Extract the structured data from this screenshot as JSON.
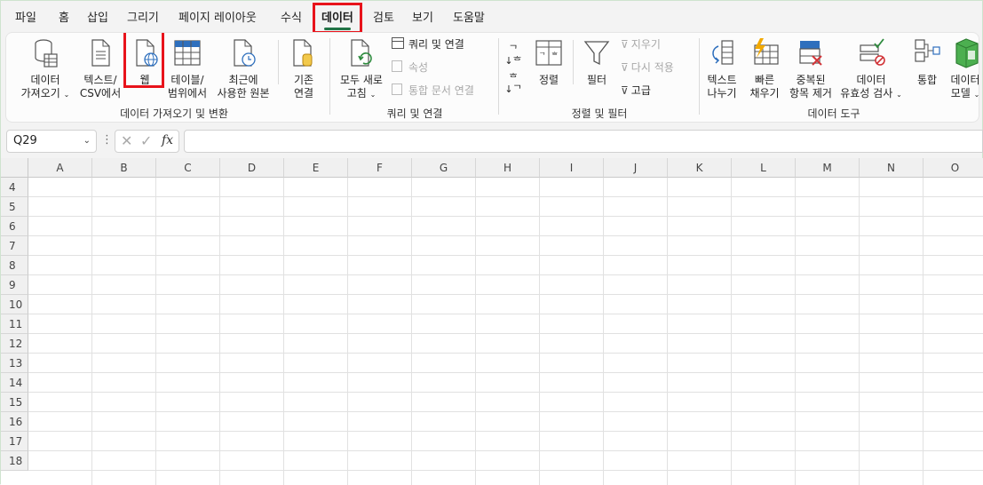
{
  "tabs": [
    {
      "label": "파일"
    },
    {
      "label": "홈"
    },
    {
      "label": "삽입"
    },
    {
      "label": "그리기"
    },
    {
      "label": "페이지 레이아웃"
    },
    {
      "label": "수식"
    },
    {
      "label": "데이터"
    },
    {
      "label": "검토"
    },
    {
      "label": "보기"
    },
    {
      "label": "도움말"
    }
  ],
  "ribbon": {
    "get_data": {
      "line1": "데이터",
      "line2": "가져오기"
    },
    "text_csv": {
      "line1": "텍스트/",
      "line2": "CSV에서"
    },
    "web": {
      "line1": "웹"
    },
    "table_range": {
      "line1": "테이블/",
      "line2": "범위에서"
    },
    "recent_sources": {
      "line1": "최근에",
      "line2": "사용한 원본"
    },
    "existing_conn": {
      "line1": "기존",
      "line2": "연결"
    },
    "group_get_transform": "데이터 가져오기 및 변환",
    "refresh_all": {
      "line1": "모두 새로",
      "line2": "고침"
    },
    "queries_conn": "쿼리 및 연결",
    "properties": "속성",
    "edit_links": "통합 문서 연결",
    "group_queries": "쿼리 및 연결",
    "sort_az": "↓",
    "sort": {
      "line1": "정렬"
    },
    "filter": {
      "line1": "필터"
    },
    "clear": "지우기",
    "reapply": "다시 적용",
    "advanced": "고급",
    "group_sort_filter": "정렬 및 필터",
    "text_to_cols": {
      "line1": "텍스트",
      "line2": "나누기"
    },
    "flash_fill": {
      "line1": "빠른",
      "line2": "채우기"
    },
    "remove_dup": {
      "line1": "중복된",
      "line2": "항목 제거"
    },
    "data_validation": {
      "line1": "데이터",
      "line2": "유효성 검사"
    },
    "consolidate": {
      "line1": "통합"
    },
    "data_model": {
      "line1": "데이터",
      "line2": "모델"
    },
    "group_data_tools": "데이터 도구"
  },
  "namebox": "Q29",
  "fx": "fx",
  "columns": [
    "A",
    "B",
    "C",
    "D",
    "E",
    "F",
    "G",
    "H",
    "I",
    "J",
    "K",
    "L",
    "M",
    "N",
    "O"
  ],
  "rows": [
    "4",
    "5",
    "6",
    "7",
    "8",
    "9",
    "10",
    "11",
    "12",
    "13",
    "14",
    "15",
    "16",
    "17",
    "18"
  ],
  "colors": {
    "accent": "#217346",
    "highlight": "#e8131b"
  }
}
